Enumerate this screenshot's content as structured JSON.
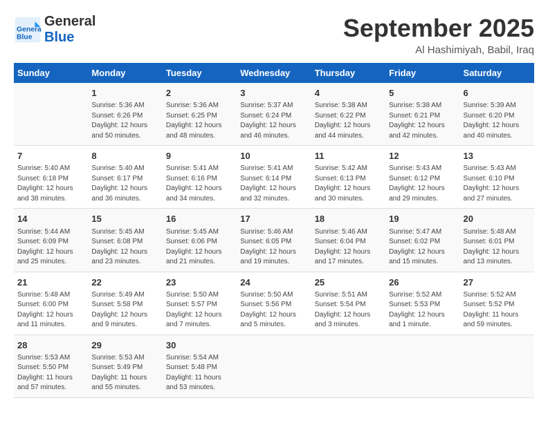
{
  "header": {
    "logo_line1": "General",
    "logo_line2": "Blue",
    "month": "September 2025",
    "location": "Al Hashimiyah, Babil, Iraq"
  },
  "days_of_week": [
    "Sunday",
    "Monday",
    "Tuesday",
    "Wednesday",
    "Thursday",
    "Friday",
    "Saturday"
  ],
  "weeks": [
    [
      {
        "day": "",
        "info": ""
      },
      {
        "day": "1",
        "info": "Sunrise: 5:36 AM\nSunset: 6:26 PM\nDaylight: 12 hours\nand 50 minutes."
      },
      {
        "day": "2",
        "info": "Sunrise: 5:36 AM\nSunset: 6:25 PM\nDaylight: 12 hours\nand 48 minutes."
      },
      {
        "day": "3",
        "info": "Sunrise: 5:37 AM\nSunset: 6:24 PM\nDaylight: 12 hours\nand 46 minutes."
      },
      {
        "day": "4",
        "info": "Sunrise: 5:38 AM\nSunset: 6:22 PM\nDaylight: 12 hours\nand 44 minutes."
      },
      {
        "day": "5",
        "info": "Sunrise: 5:38 AM\nSunset: 6:21 PM\nDaylight: 12 hours\nand 42 minutes."
      },
      {
        "day": "6",
        "info": "Sunrise: 5:39 AM\nSunset: 6:20 PM\nDaylight: 12 hours\nand 40 minutes."
      }
    ],
    [
      {
        "day": "7",
        "info": "Sunrise: 5:40 AM\nSunset: 6:18 PM\nDaylight: 12 hours\nand 38 minutes."
      },
      {
        "day": "8",
        "info": "Sunrise: 5:40 AM\nSunset: 6:17 PM\nDaylight: 12 hours\nand 36 minutes."
      },
      {
        "day": "9",
        "info": "Sunrise: 5:41 AM\nSunset: 6:16 PM\nDaylight: 12 hours\nand 34 minutes."
      },
      {
        "day": "10",
        "info": "Sunrise: 5:41 AM\nSunset: 6:14 PM\nDaylight: 12 hours\nand 32 minutes."
      },
      {
        "day": "11",
        "info": "Sunrise: 5:42 AM\nSunset: 6:13 PM\nDaylight: 12 hours\nand 30 minutes."
      },
      {
        "day": "12",
        "info": "Sunrise: 5:43 AM\nSunset: 6:12 PM\nDaylight: 12 hours\nand 29 minutes."
      },
      {
        "day": "13",
        "info": "Sunrise: 5:43 AM\nSunset: 6:10 PM\nDaylight: 12 hours\nand 27 minutes."
      }
    ],
    [
      {
        "day": "14",
        "info": "Sunrise: 5:44 AM\nSunset: 6:09 PM\nDaylight: 12 hours\nand 25 minutes."
      },
      {
        "day": "15",
        "info": "Sunrise: 5:45 AM\nSunset: 6:08 PM\nDaylight: 12 hours\nand 23 minutes."
      },
      {
        "day": "16",
        "info": "Sunrise: 5:45 AM\nSunset: 6:06 PM\nDaylight: 12 hours\nand 21 minutes."
      },
      {
        "day": "17",
        "info": "Sunrise: 5:46 AM\nSunset: 6:05 PM\nDaylight: 12 hours\nand 19 minutes."
      },
      {
        "day": "18",
        "info": "Sunrise: 5:46 AM\nSunset: 6:04 PM\nDaylight: 12 hours\nand 17 minutes."
      },
      {
        "day": "19",
        "info": "Sunrise: 5:47 AM\nSunset: 6:02 PM\nDaylight: 12 hours\nand 15 minutes."
      },
      {
        "day": "20",
        "info": "Sunrise: 5:48 AM\nSunset: 6:01 PM\nDaylight: 12 hours\nand 13 minutes."
      }
    ],
    [
      {
        "day": "21",
        "info": "Sunrise: 5:48 AM\nSunset: 6:00 PM\nDaylight: 12 hours\nand 11 minutes."
      },
      {
        "day": "22",
        "info": "Sunrise: 5:49 AM\nSunset: 5:58 PM\nDaylight: 12 hours\nand 9 minutes."
      },
      {
        "day": "23",
        "info": "Sunrise: 5:50 AM\nSunset: 5:57 PM\nDaylight: 12 hours\nand 7 minutes."
      },
      {
        "day": "24",
        "info": "Sunrise: 5:50 AM\nSunset: 5:56 PM\nDaylight: 12 hours\nand 5 minutes."
      },
      {
        "day": "25",
        "info": "Sunrise: 5:51 AM\nSunset: 5:54 PM\nDaylight: 12 hours\nand 3 minutes."
      },
      {
        "day": "26",
        "info": "Sunrise: 5:52 AM\nSunset: 5:53 PM\nDaylight: 12 hours\nand 1 minute."
      },
      {
        "day": "27",
        "info": "Sunrise: 5:52 AM\nSunset: 5:52 PM\nDaylight: 11 hours\nand 59 minutes."
      }
    ],
    [
      {
        "day": "28",
        "info": "Sunrise: 5:53 AM\nSunset: 5:50 PM\nDaylight: 11 hours\nand 57 minutes."
      },
      {
        "day": "29",
        "info": "Sunrise: 5:53 AM\nSunset: 5:49 PM\nDaylight: 11 hours\nand 55 minutes."
      },
      {
        "day": "30",
        "info": "Sunrise: 5:54 AM\nSunset: 5:48 PM\nDaylight: 11 hours\nand 53 minutes."
      },
      {
        "day": "",
        "info": ""
      },
      {
        "day": "",
        "info": ""
      },
      {
        "day": "",
        "info": ""
      },
      {
        "day": "",
        "info": ""
      }
    ]
  ]
}
